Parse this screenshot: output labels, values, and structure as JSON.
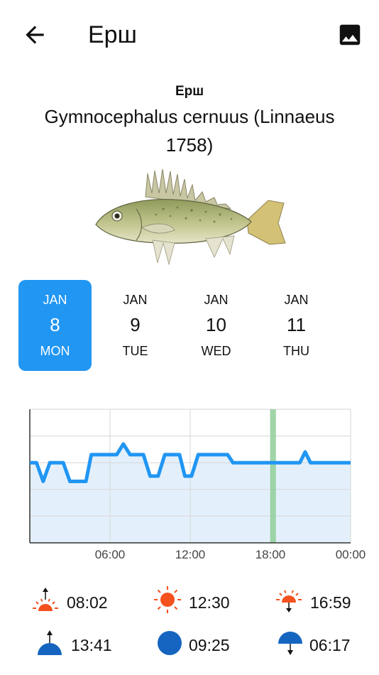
{
  "app_bar": {
    "title": "Ерш",
    "back_icon": "arrow-back-icon",
    "image_icon": "image-icon"
  },
  "fish": {
    "local_name": "Ерш",
    "scientific_name": "Gymnocephalus cernuus (Linnaeus 1758)"
  },
  "days": [
    {
      "month": "JAN",
      "day": "8",
      "weekday": "MON",
      "selected": true
    },
    {
      "month": "JAN",
      "day": "9",
      "weekday": "TUE",
      "selected": false
    },
    {
      "month": "JAN",
      "day": "10",
      "weekday": "WED",
      "selected": false
    },
    {
      "month": "JAN",
      "day": "11",
      "weekday": "THU",
      "selected": false
    }
  ],
  "chart_data": {
    "type": "line",
    "x_unit": "hours",
    "xlim": [
      0,
      24
    ],
    "ylim": [
      0,
      5
    ],
    "x_ticks": [
      {
        "value": 6,
        "label": "06:00"
      },
      {
        "value": 12,
        "label": "12:00"
      },
      {
        "value": 18,
        "label": "18:00"
      },
      {
        "value": 24,
        "label": "00:00"
      }
    ],
    "y_ticks_labels": [],
    "grid": true,
    "current_time_marker": 18.2,
    "series": [
      {
        "color": "#2196f3",
        "fill": "#e3f0fc",
        "points": [
          [
            0,
            3
          ],
          [
            0.5,
            3
          ],
          [
            1,
            2.3
          ],
          [
            1.5,
            3
          ],
          [
            2.5,
            3
          ],
          [
            3,
            2.3
          ],
          [
            4.2,
            2.3
          ],
          [
            4.6,
            3.3
          ],
          [
            6.5,
            3.3
          ],
          [
            7,
            3.7
          ],
          [
            7.5,
            3.3
          ],
          [
            8.5,
            3.3
          ],
          [
            9,
            2.5
          ],
          [
            9.6,
            2.5
          ],
          [
            10.1,
            3.3
          ],
          [
            11.2,
            3.3
          ],
          [
            11.6,
            2.5
          ],
          [
            12.1,
            2.5
          ],
          [
            12.6,
            3.3
          ],
          [
            14.8,
            3.3
          ],
          [
            15.2,
            3
          ],
          [
            20.2,
            3
          ],
          [
            20.6,
            3.4
          ],
          [
            21,
            3
          ],
          [
            24,
            3
          ]
        ]
      }
    ]
  },
  "sun_moon": {
    "sunrise": "08:02",
    "sun_transit": "12:30",
    "sunset": "16:59",
    "moonrise": "13:41",
    "moon_transit": "09:25",
    "moonset": "06:17",
    "sun_color": "#f4511e",
    "moon_color": "#1565c0"
  }
}
